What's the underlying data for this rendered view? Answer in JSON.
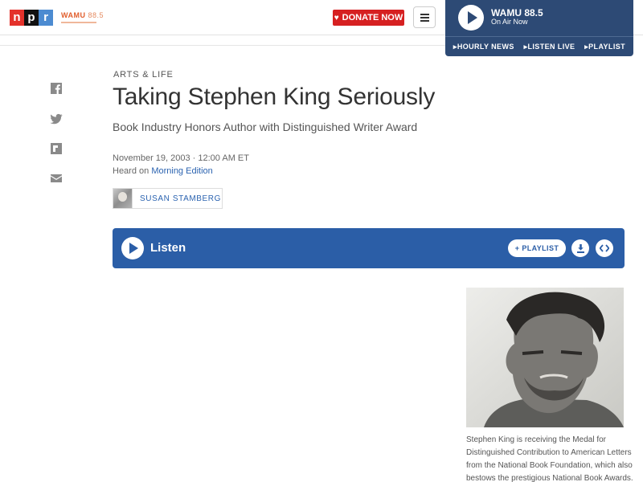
{
  "header": {
    "logo_letters": [
      "n",
      "p",
      "r"
    ],
    "station_logo": "WAMU",
    "station_logo_freq": "88.5",
    "donate_label": "DONATE NOW",
    "donate_icon": "heart-icon",
    "menu_icon": "hamburger-menu-icon"
  },
  "player": {
    "station": "WAMU 88.5",
    "status": "On Air Now",
    "links": [
      "HOURLY NEWS",
      "LISTEN LIVE",
      "PLAYLIST"
    ]
  },
  "share": [
    "facebook-icon",
    "twitter-icon",
    "flipboard-icon",
    "email-icon"
  ],
  "article": {
    "slug": "ARTS & LIFE",
    "title": "Taking Stephen King Seriously",
    "teaser": "Book Industry Honors Author with Distinguished Writer Award",
    "date": "November 19, 2003 · 12:00 AM ET",
    "heard_prefix": "Heard on ",
    "heard_show": "Morning Edition",
    "author": "SUSAN STAMBERG"
  },
  "listen": {
    "label": "Listen",
    "playlist_label": "PLAYLIST",
    "download_icon": "download-icon",
    "embed_icon": "embed-code-icon"
  },
  "photo": {
    "caption": "Stephen King is receiving the Medal for Distinguished Contribution to American Letters from the National Book Foundation, which also bestows the prestigious National Book Awards."
  },
  "colors": {
    "npr_red": "#e4322b",
    "npr_blue": "#4c8bd1",
    "donate": "#d62021",
    "player": "#2d4a75",
    "listen_bar": "#2b5ea7",
    "link": "#2b63b0"
  }
}
